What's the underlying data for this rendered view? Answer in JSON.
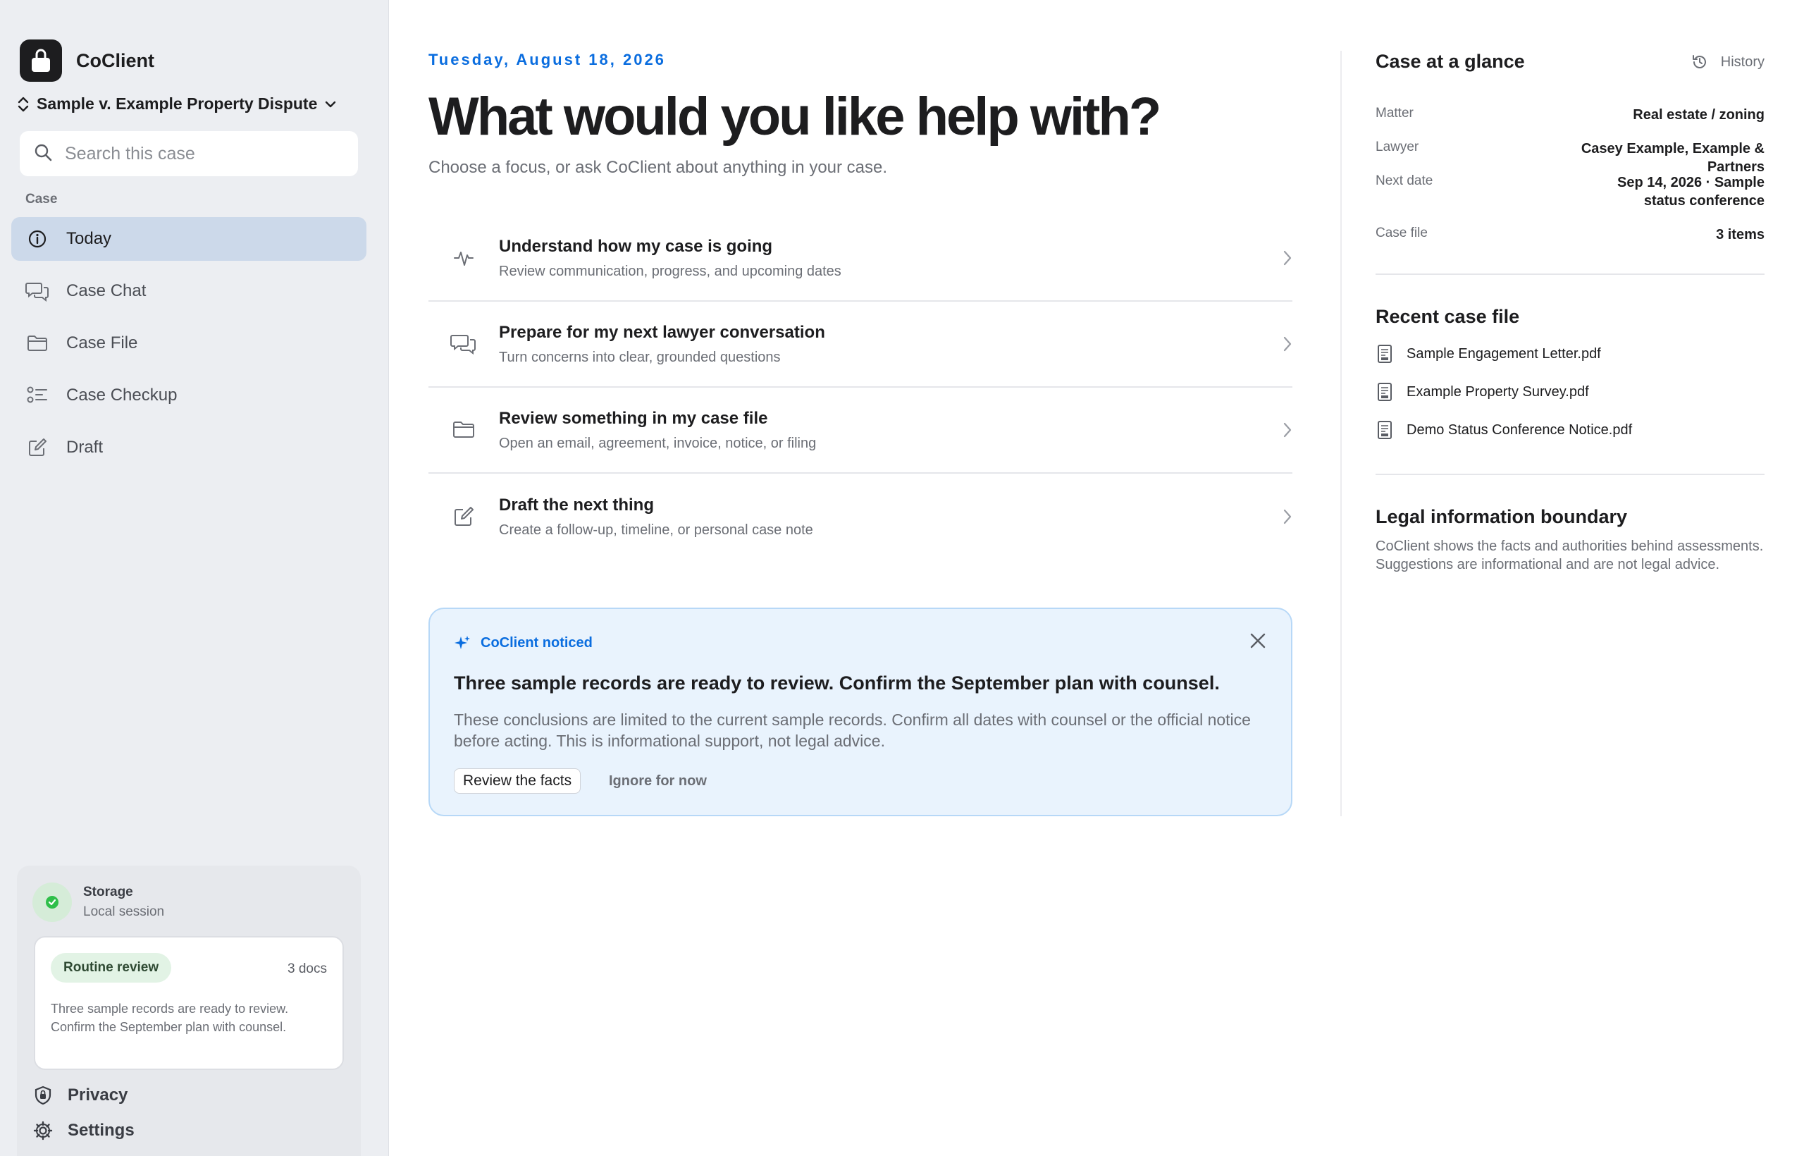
{
  "app": {
    "name": "CoClient"
  },
  "case_switcher": {
    "label": "Sample v. Example Property Dispute"
  },
  "search": {
    "placeholder": "Search this case"
  },
  "sidebar": {
    "section_label": "Case",
    "items": [
      {
        "label": "Today",
        "icon": "info-circle-icon",
        "active": true
      },
      {
        "label": "Case Chat",
        "icon": "chat-bubbles-icon"
      },
      {
        "label": "Case File",
        "icon": "folder-icon"
      },
      {
        "label": "Case Checkup",
        "icon": "checklist-icon"
      },
      {
        "label": "Draft",
        "icon": "compose-icon"
      }
    ],
    "storage": {
      "title": "Storage",
      "subtitle": "Local session"
    },
    "review_card": {
      "pill": "Routine review",
      "docs": "3 docs",
      "body": "Three sample records are ready to review. Confirm the September plan with counsel."
    },
    "privacy_label": "Privacy",
    "settings_label": "Settings"
  },
  "main": {
    "date": "Tuesday, August 18, 2026",
    "headline": "What would you like help with?",
    "subline": "Choose a focus, or ask CoClient about anything in your case.",
    "focus_items": [
      {
        "title": "Understand how my case is going",
        "subtitle": "Review communication, progress, and upcoming dates",
        "icon": "pulse-icon"
      },
      {
        "title": "Prepare for my next lawyer conversation",
        "subtitle": "Turn concerns into clear, grounded questions",
        "icon": "chat-bubbles-icon"
      },
      {
        "title": "Review something in my case file",
        "subtitle": "Open an email, agreement, invoice, notice, or filing",
        "icon": "folder-icon"
      },
      {
        "title": "Draft the next thing",
        "subtitle": "Create a follow-up, timeline, or personal case note",
        "icon": "compose-icon"
      }
    ],
    "notice": {
      "tag": "CoClient noticed",
      "title": "Three sample records are ready to review. Confirm the September plan with counsel.",
      "body": "These conclusions are limited to the current sample records. Confirm all dates with counsel or the official notice before acting. This is informational support, not legal advice.",
      "primary_button": "Review the facts",
      "secondary_button": "Ignore for now"
    }
  },
  "right_panel": {
    "title": "Case at a glance",
    "history_label": "History",
    "facts": [
      {
        "key": "Matter",
        "value": "Real estate / zoning"
      },
      {
        "key": "Lawyer",
        "value": "Casey Example, Example & Partners"
      },
      {
        "key": "Next date",
        "value": "Sep 14, 2026 · Sample status conference"
      },
      {
        "key": "Case file",
        "value": "3 items"
      }
    ],
    "recent_title": "Recent case file",
    "recent_files": [
      "Sample Engagement Letter.pdf",
      "Example Property Survey.pdf",
      "Demo Status Conference Notice.pdf"
    ],
    "boundary_title": "Legal information boundary",
    "boundary_text": "CoClient shows the facts and authorities behind assessments. Suggestions are informational and are not legal advice."
  },
  "colors": {
    "accent": "#0a6ddf",
    "sidebar_bg": "#eceef2",
    "active_nav": "#ccd9ea",
    "notice_bg": "#e9f3fd",
    "success": "#2fbf4a"
  }
}
